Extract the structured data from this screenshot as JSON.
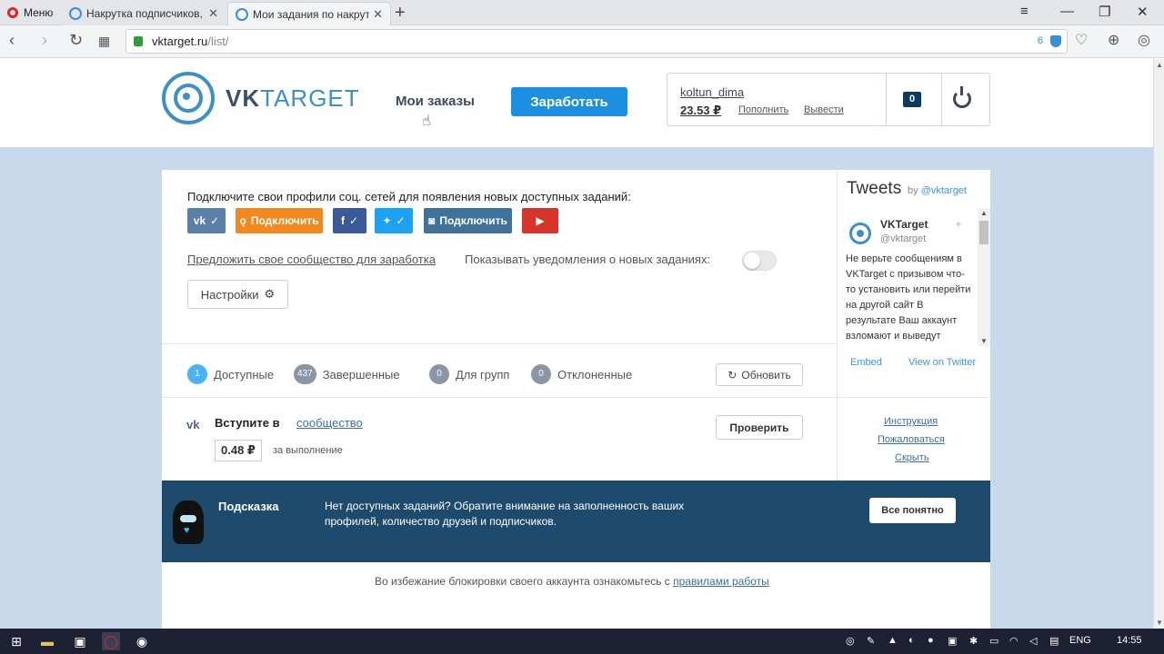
{
  "browser": {
    "menu_label": "Меню",
    "tabs": [
      {
        "title": "Накрутка подписчиков, л"
      },
      {
        "title": "Мои задания по накрутке"
      }
    ],
    "url_host": "vktarget.ru",
    "url_path": "/list/",
    "url_badge": "6"
  },
  "header": {
    "logo_vk": "VK",
    "logo_target": "TARGET",
    "my_orders": "Мои заказы",
    "earn": "Заработать",
    "username": "koltun_dima",
    "balance": "23.53 ₽",
    "topup": "Пополнить",
    "withdraw": "Вывести",
    "notifications": "0"
  },
  "connect": {
    "title": "Подключите свои профили соц. сетей для появления новых доступных заданий:",
    "buttons": [
      {
        "icon": "vk-icon",
        "label": "✓",
        "color": "#5b7fa6"
      },
      {
        "icon": "ok-icon",
        "label": "Подключить",
        "color": "#f08a1e"
      },
      {
        "icon": "fb-icon",
        "label": "✓",
        "color": "#3b5998"
      },
      {
        "icon": "twitter-icon",
        "label": "✓",
        "color": "#1da1f2"
      },
      {
        "icon": "instagram-icon",
        "label": "Подключить",
        "color": "#3f729b"
      },
      {
        "icon": "youtube-icon",
        "label": "",
        "color": "#d9342b"
      }
    ],
    "suggest_link": "Предложить свое сообщество для заработка",
    "notify_label": "Показывать уведомления о новых заданиях:",
    "notify_on": false,
    "settings_label": "Настройки"
  },
  "filters": [
    {
      "count": "1",
      "label": "Доступные"
    },
    {
      "count": "437",
      "label": "Завершенные"
    },
    {
      "count": "0",
      "label": "Для групп"
    },
    {
      "count": "0",
      "label": "Отклоненные"
    }
  ],
  "refresh_label": "Обновить",
  "task": {
    "text": "Вступите в",
    "link": "сообщество",
    "price": "0.48 ₽",
    "price_note": "за выполнение",
    "check_label": "Проверить",
    "side_links": [
      "Инструкция",
      "Пожаловаться",
      "Скрыть"
    ]
  },
  "hint": {
    "title": "Подсказка",
    "text": "Нет доступных заданий? Обратите внимание на заполненность ваших профилей, количество друзей и подписчиков.",
    "ok_label": "Все понятно"
  },
  "rules": {
    "text": "Во избежание блокировки своего аккаунта ознакомьтесь с",
    "link": "правилами работы"
  },
  "tweets": {
    "title": "Tweets",
    "by": "by",
    "by_handle": "@vktarget",
    "name": "VKTarget",
    "handle": "@vktarget",
    "text": "Не верьте сообщениям в VKTarget с призывом что-то установить или перейти на другой сайт В результате Ваш аккаунт взломают и выведут",
    "embed": "Embed",
    "view": "View on Twitter"
  },
  "taskbar": {
    "lang": "ENG",
    "time": "14:55"
  }
}
